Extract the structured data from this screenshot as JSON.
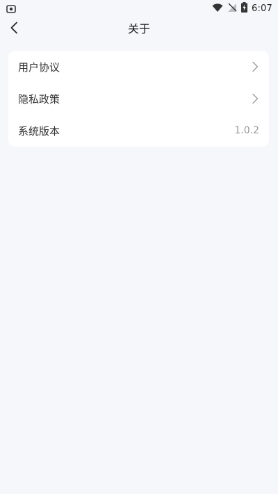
{
  "status_bar": {
    "time": "6:07"
  },
  "header": {
    "title": "关于"
  },
  "menu": {
    "items": [
      {
        "label": "用户协议"
      },
      {
        "label": "隐私政策"
      },
      {
        "label": "系统版本",
        "value": "1.0.2"
      }
    ]
  },
  "colors": {
    "background": "#f6f7fb",
    "card": "#ffffff",
    "text": "#333333",
    "muted": "#9a9a9a"
  }
}
